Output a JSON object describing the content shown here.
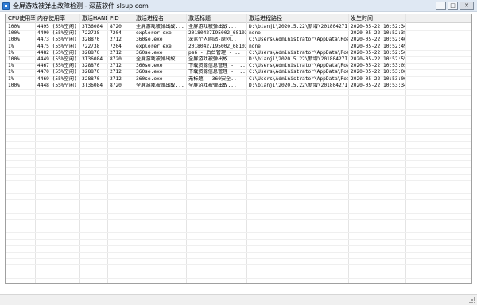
{
  "window": {
    "title": "全屏游戏被弹出故障检测 - 深蓝软件 slsup.com"
  },
  "columns": [
    "CPU使用率",
    "内存使用率",
    "激活HAND",
    "PID",
    "激活进程名",
    "激活标题",
    "激活进程路径",
    "发生时间"
  ],
  "rows": [
    [
      "100%",
      "4495 (55%空闲)",
      "3T36084",
      "8720",
      "全屏游戏被弹出故...",
      "全屏游戏被弹出故...",
      "D:\\bianji\\2020.5.22\\新增\\20180427I...",
      "2020-05-22 10:52:34"
    ],
    [
      "100%",
      "4490 (55%空闲)",
      "722738",
      "7204",
      "explorer.exe",
      "20180427I95002_68103",
      "none",
      "2020-05-22 10:52:38"
    ],
    [
      "100%",
      "4473 (55%空闲)",
      "328870",
      "2712",
      "360se.exe",
      "深蓝个人网站-原创...",
      "C:\\Users\\Administrator\\AppData\\Roa...",
      "2020-05-22 10:52:46"
    ],
    [
      "1%",
      "4475 (55%空闲)",
      "722738",
      "7204",
      "explorer.exe",
      "20180427I95002_68103",
      "none",
      "2020-05-22 10:52:49"
    ],
    [
      "1%",
      "4482 (55%空闲)",
      "328870",
      "2712",
      "360se.exe",
      "ps6 - 后台管理 - ...",
      "C:\\Users\\Administrator\\AppData\\Roa...",
      "2020-05-22 10:52:50"
    ],
    [
      "100%",
      "4449 (55%空闲)",
      "3T36084",
      "8720",
      "全屏游戏被弹出故...",
      "全屏游戏被弹出故...",
      "D:\\bianji\\2020.5.22\\新增\\20180427I...",
      "2020-05-22 10:52:55"
    ],
    [
      "1%",
      "4467 (55%空闲)",
      "328870",
      "2712",
      "360se.exe",
      "下载资源信息管理 - ...",
      "C:\\Users\\Administrator\\AppData\\Roa...",
      "2020-05-22 10:53:05"
    ],
    [
      "1%",
      "4470 (55%空闲)",
      "328870",
      "2712",
      "360se.exe",
      "下载资源信息管理 - ...",
      "C:\\Users\\Administrator\\AppData\\Roa...",
      "2020-05-22 10:53:06"
    ],
    [
      "1%",
      "4469 (55%空闲)",
      "328870",
      "2712",
      "360se.exe",
      "无标题 - 360安全...",
      "C:\\Users\\Administrator\\AppData\\Roa...",
      "2020-05-22 10:53:06"
    ],
    [
      "100%",
      "4448 (55%空闲)",
      "3T36084",
      "8720",
      "全屏游戏被弹出故...",
      "全屏游戏被弹出故...",
      "D:\\bianji\\2020.5.22\\新增\\20180427I...",
      "2020-05-22 10:53:34"
    ]
  ],
  "icons": {
    "app": "app-icon",
    "minimize": "minimize-icon",
    "maximize": "maximize-icon",
    "close": "close-icon"
  },
  "colors": {
    "titlebar": "#dfe8f3",
    "header": "#f0f0f0",
    "grid_border": "#a0a0a0"
  }
}
